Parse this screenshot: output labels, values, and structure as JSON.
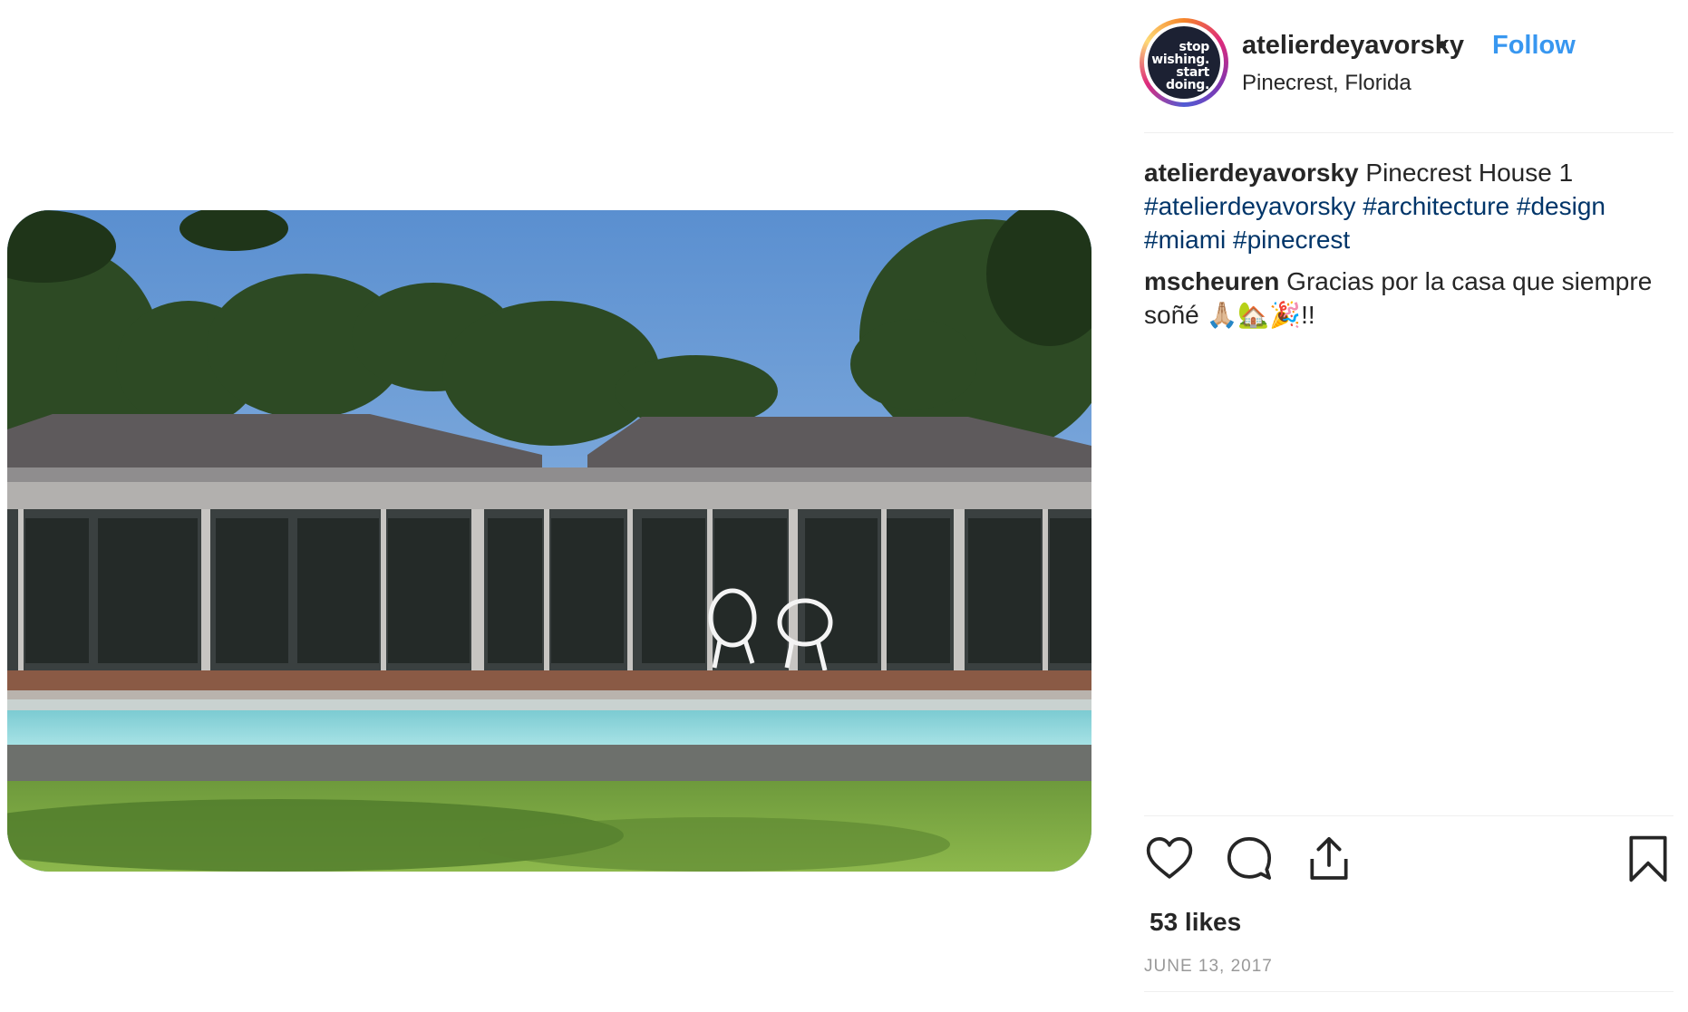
{
  "post": {
    "username": "atelierdeyavorsky",
    "separator": "•",
    "follow_label": "Follow",
    "location": "Pinecrest, Florida",
    "avatar_text": [
      "stop",
      "wishing.",
      "start",
      "doing."
    ],
    "caption": {
      "username": "atelierdeyavorsky",
      "text": " Pinecrest House 1",
      "hashtags": [
        "#atelierdeyavorsky",
        "#architecture",
        "#design",
        "#miami",
        "#pinecrest"
      ]
    },
    "comment": {
      "username": "mscheuren",
      "text": " Gracias por la casa que siempre soñé 🙏🏼🏡🎉!!"
    },
    "likes": "53 likes",
    "date": "JUNE 13, 2017"
  },
  "icons": [
    "heart-icon",
    "comment-icon",
    "share-icon",
    "bookmark-icon"
  ],
  "colors": {
    "follow": "#3897f0",
    "hashtag": "#003569",
    "text": "#262626",
    "muted": "#999999",
    "divider": "#efefef"
  }
}
